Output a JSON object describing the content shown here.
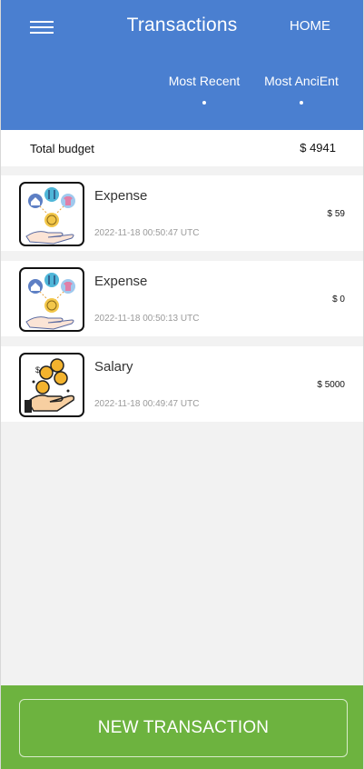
{
  "header": {
    "title": "Transactions",
    "home_label": "HOME",
    "sort_tabs": [
      {
        "label": "Most Recent"
      },
      {
        "label": "Most AnciEnt"
      }
    ]
  },
  "budget": {
    "label": "Total budget",
    "amount": "$ 4941"
  },
  "transactions": [
    {
      "name": "Expense",
      "date": "2022-11-18 00:50:47 UTC",
      "amount": "$ 59",
      "icon": "expense-categories-icon"
    },
    {
      "name": "Expense",
      "date": "2022-11-18 00:50:13 UTC",
      "amount": "$ 0",
      "icon": "expense-categories-icon"
    },
    {
      "name": "Salary",
      "date": "2022-11-18 00:49:47 UTC",
      "amount": "$ 5000",
      "icon": "salary-coins-icon"
    }
  ],
  "footer": {
    "new_transaction_label": "NEW TRANSACTION"
  },
  "colors": {
    "header_bg": "#4a7fd0",
    "footer_bg": "#6db33f",
    "page_bg": "#f2f2f2"
  }
}
